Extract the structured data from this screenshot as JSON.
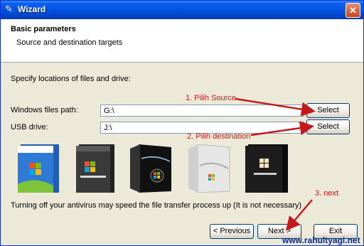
{
  "window": {
    "title": "Wizard",
    "close_symbol": "✕"
  },
  "header": {
    "title": "Basic parameters",
    "subtitle": "Source and destination targets"
  },
  "form": {
    "intro": "Specify locations of files and drive:",
    "windows_path_label": "Windows files path:",
    "windows_path_value": "G:\\",
    "usb_label": "USB drive:",
    "usb_value": "J:\\",
    "select_label": "Select"
  },
  "products": [
    {
      "name": "Windows XP",
      "icon": "windows-xp-box"
    },
    {
      "name": "Windows Server 2003",
      "icon": "windows-server-2003-box"
    },
    {
      "name": "Windows Vista",
      "icon": "windows-vista-box"
    },
    {
      "name": "Windows Server 2008",
      "icon": "windows-server-2008-box"
    },
    {
      "name": "Windows 7",
      "icon": "windows-7-box"
    }
  ],
  "note": "Turning off your antivirus may speed the file transfer process up (It is not necessary)",
  "annotations": {
    "step1": "1. Pilih Source",
    "step2": "2. Pilih destination",
    "step3": "3. next",
    "arrow_color": "#c5191b"
  },
  "buttons": {
    "previous": "< Previous",
    "next": "Next >",
    "exit": "Exit"
  },
  "watermark": "www.rahultyagi.net"
}
